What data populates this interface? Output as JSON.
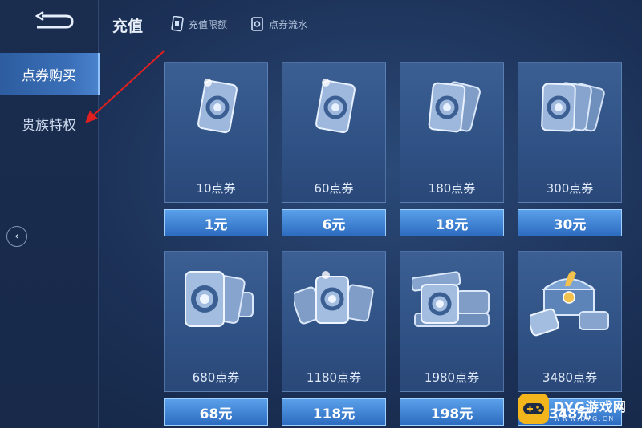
{
  "sidebar": {
    "back_icon": "back-arrow-icon",
    "items": [
      {
        "label": "点券购买",
        "active": true
      },
      {
        "label": "贵族特权",
        "active": false
      }
    ],
    "page_arrow": "‹"
  },
  "header": {
    "title": "充值",
    "links": [
      {
        "label": "充值限额",
        "icon": "card-icon"
      },
      {
        "label": "点券流水",
        "icon": "coupon-icon"
      }
    ]
  },
  "products": [
    {
      "amount": "10点券",
      "price": "1元",
      "art": "single-coupon"
    },
    {
      "amount": "60点券",
      "price": "6元",
      "art": "single-coupon"
    },
    {
      "amount": "180点券",
      "price": "18元",
      "art": "double-coupon"
    },
    {
      "amount": "300点券",
      "price": "30元",
      "art": "triple-coupon"
    },
    {
      "amount": "680点券",
      "price": "68元",
      "art": "fan-coupon"
    },
    {
      "amount": "1180点券",
      "price": "118元",
      "art": "stack-coupon"
    },
    {
      "amount": "1980点券",
      "price": "198元",
      "art": "pile-coupon"
    },
    {
      "amount": "3480点券",
      "price": "348元",
      "art": "chest-coupon"
    }
  ],
  "watermark": {
    "title": "DYG游戏网",
    "url": "WWW.DYG.CN"
  },
  "colors": {
    "accent": "#3a6fb8",
    "price_button": "#2d6cc0",
    "annotation_arrow": "#e02020"
  }
}
